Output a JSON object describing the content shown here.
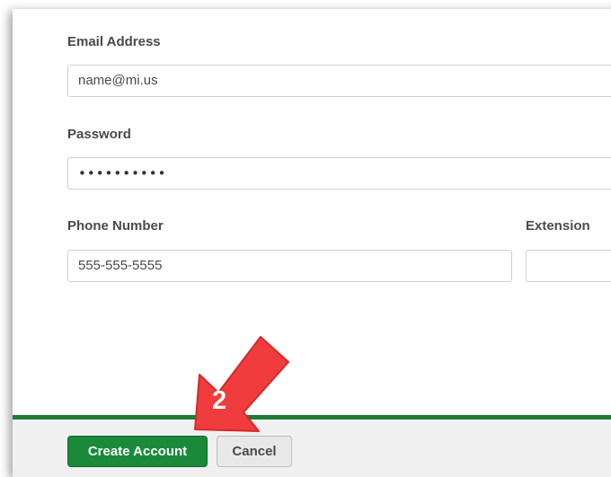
{
  "form": {
    "email": {
      "label": "Email Address",
      "value": "name@mi.us"
    },
    "password": {
      "label": "Password",
      "value": "••••••••••"
    },
    "phone": {
      "label": "Phone Number",
      "value": "555-555-5555"
    },
    "extension": {
      "label": "Extension",
      "value": ""
    }
  },
  "footer": {
    "create_label": "Create Account",
    "cancel_label": "Cancel"
  },
  "annotation": {
    "step": "2",
    "icon": "pointer-arrow-icon",
    "color": "#f03c3c"
  },
  "colors": {
    "brand_green": "#1a8a3a",
    "footer_border": "#1f7a36"
  }
}
